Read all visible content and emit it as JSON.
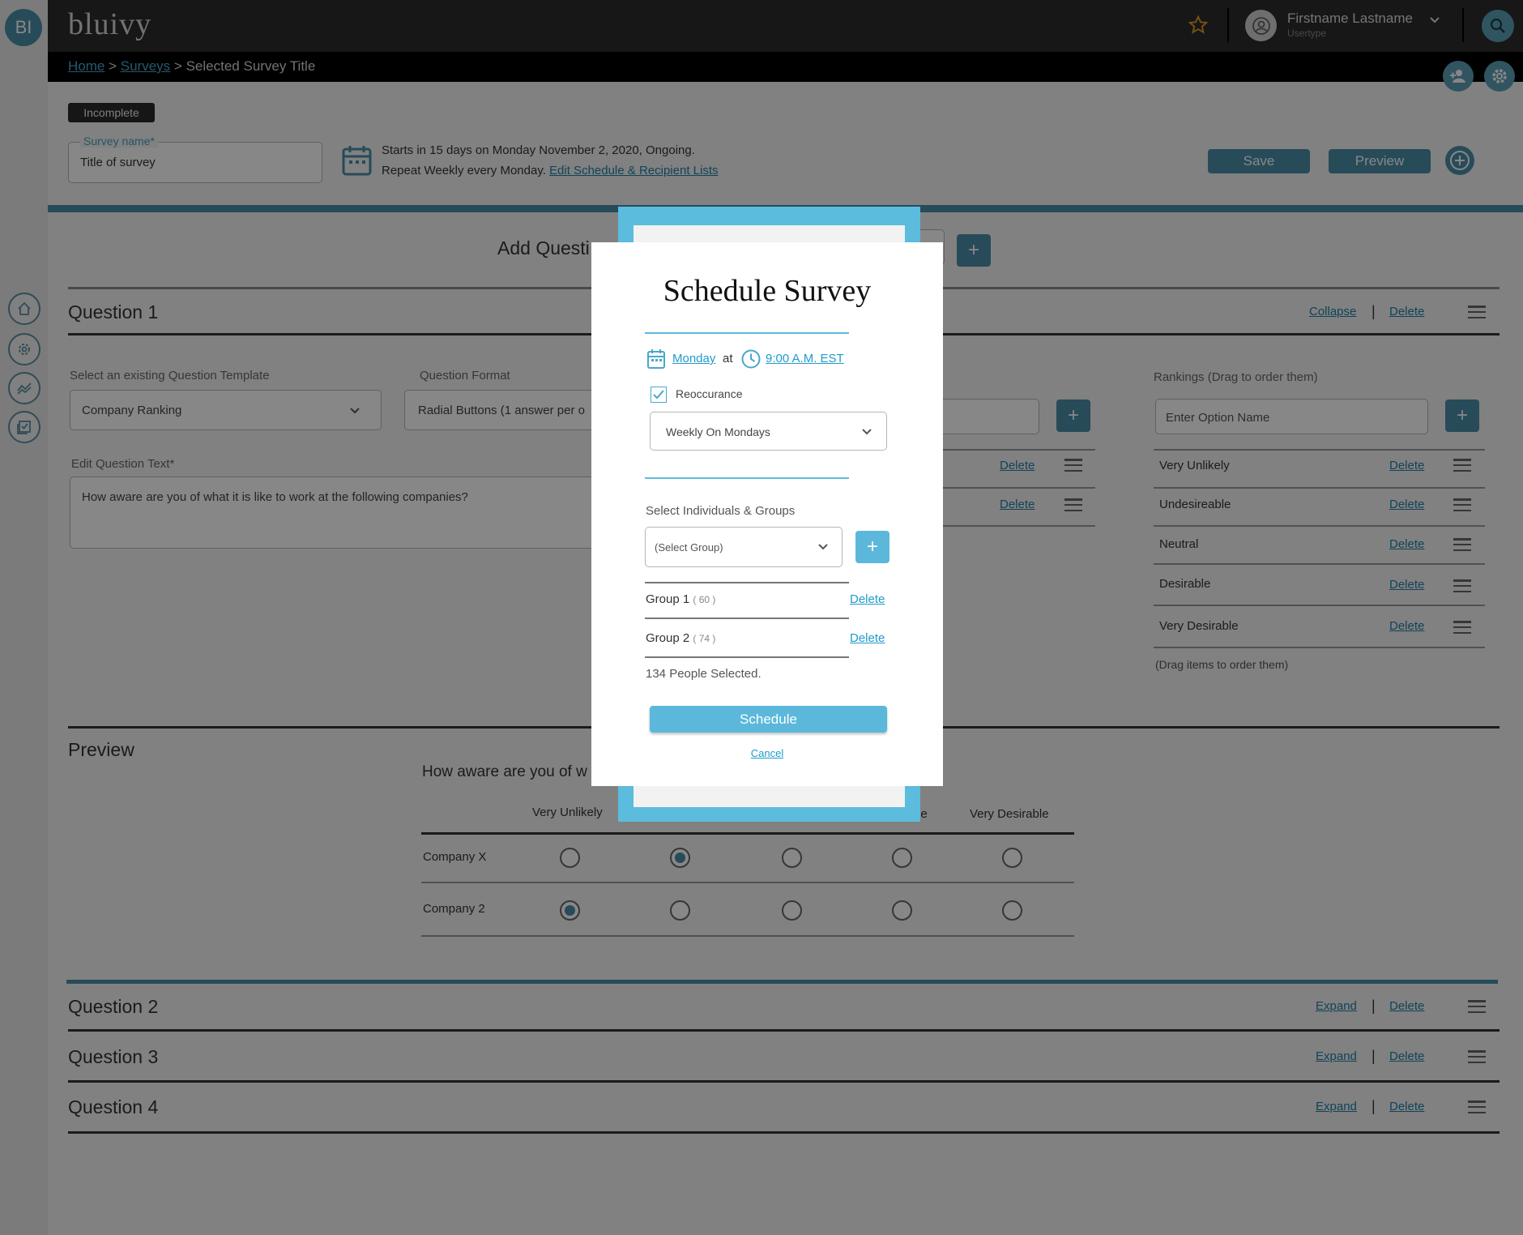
{
  "app": {
    "initials": "BI",
    "logo": "bluivy"
  },
  "user": {
    "name": "Firstname Lastname",
    "type": "Usertype"
  },
  "breadcrumb": {
    "home": "Home",
    "sep1": ">",
    "surveys": "Surveys",
    "sep2": ">",
    "current": "Selected Survey Title"
  },
  "survey": {
    "status": "Incomplete",
    "name_label": "Survey name*",
    "name_value": "Title of survey",
    "schedule_line1": "Starts in 15 days on Monday November 2, 2020, Ongoing.",
    "schedule_line2": "Repeat Weekly every Monday.",
    "edit_link": "Edit Schedule & Recipient Lists",
    "save": "Save",
    "preview": "Preview"
  },
  "add_question": {
    "label": "Add Questi",
    "add": "+"
  },
  "question1": {
    "title": "Question 1",
    "collapse": "Collapse",
    "pipe": "|",
    "delete": "Delete",
    "template_label": "Select an existing Question Template",
    "template_value": "Company Ranking",
    "format_label": "Question Format",
    "format_value": "Radial Buttons (1 answer per o",
    "text_label": "Edit Question Text*",
    "text_value": "How aware are you of what it is like to work at the following companies?",
    "mid_deletes": [
      "Delete",
      "Delete"
    ],
    "rankings_label": "Rankings (Drag to order them)",
    "option_placeholder": "Enter Option Name",
    "rankings": [
      {
        "label": "Very Unlikely",
        "delete": "Delete"
      },
      {
        "label": "Undesireable",
        "delete": "Delete"
      },
      {
        "label": "Neutral",
        "delete": "Delete"
      },
      {
        "label": "Desirable",
        "delete": "Delete"
      },
      {
        "label": "Very Desirable",
        "delete": "Delete"
      }
    ],
    "rankings_note": "(Drag items to order them)"
  },
  "preview": {
    "title": "Preview",
    "question": "How aware are you of w",
    "col1": "Very Unlikely",
    "col4_frag": "le",
    "col5": "Very Desirable",
    "rows": [
      {
        "label": "Company X",
        "selected": 2
      },
      {
        "label": "Company 2",
        "selected": 1
      }
    ]
  },
  "other_questions": [
    {
      "title": "Question 2",
      "expand": "Expand",
      "pipe": "|",
      "delete": "Delete"
    },
    {
      "title": "Question 3",
      "expand": "Expand",
      "pipe": "|",
      "delete": "Delete"
    },
    {
      "title": "Question 4",
      "expand": "Expand",
      "pipe": "|",
      "delete": "Delete"
    }
  ],
  "modal": {
    "title": "Schedule Survey",
    "day": "Monday",
    "at": "at",
    "time": "9:00 A.M. EST",
    "recurrence_label": "Reoccurance",
    "recurrence_checked": true,
    "recurrence_value": "Weekly On Mondays",
    "select_label": "Select Individuals & Groups",
    "group_placeholder": "(Select Group)",
    "add": "+",
    "groups": [
      {
        "name": "Group 1",
        "count": "( 60 )",
        "delete": "Delete"
      },
      {
        "name": "Group 2",
        "count": "( 74 )",
        "delete": "Delete"
      }
    ],
    "selected_summary": "134 People Selected.",
    "schedule_button": "Schedule",
    "cancel": "Cancel"
  },
  "colors": {
    "accent": "#4a8fa8",
    "modal_frame": "#5bbcde",
    "topbar": "#2c2c2c"
  },
  "icons": [
    "home-icon",
    "gear-icon",
    "chart-icon",
    "checklist-icon",
    "star-icon",
    "user-icon",
    "search-icon",
    "add-user-icon",
    "settings-icon",
    "add-circle-icon",
    "calendar-icon",
    "clock-icon",
    "chevron-down-icon"
  ]
}
